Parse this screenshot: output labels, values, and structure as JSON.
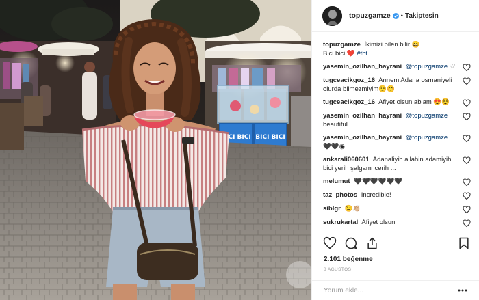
{
  "post": {
    "username": "topuzgamze",
    "verified": true,
    "follow_label": "Takiptesin",
    "caption_text": "İkimizi bilen bilir 😄",
    "caption_line2": "Bici bici",
    "caption_heart": "❤️",
    "caption_tag": "#tbt",
    "likes": "2.101 beğenme",
    "date": "8 AĞUSTOS",
    "comment_placeholder": "Yorum ekle..."
  },
  "photo": {
    "sign_text_1": "BICI BICI",
    "sign_text_2": "BICI BICI"
  },
  "comments": [
    {
      "user": "yasemin_ozilhan_hayrani",
      "mention": "@topuzgamze",
      "text": "♡"
    },
    {
      "user": "tugceacikgoz_16",
      "mention": "",
      "text": "Annem Adana osmaniyeli olurda bilmezmiyim😉😊"
    },
    {
      "user": "tugceacikgoz_16",
      "mention": "",
      "text": "Afiyet olsun ablam 😍😵"
    },
    {
      "user": "yasemin_ozilhan_hayrani",
      "mention": "@topuzgamze",
      "text": "beautiful"
    },
    {
      "user": "yasemin_ozilhan_hayrani",
      "mention": "@topuzgamze",
      "text": "🖤🖤◉"
    },
    {
      "user": "ankarali060601",
      "mention": "",
      "text": "Adanaliyih allahin adamiyih bici yerih şalgam icerih ..."
    },
    {
      "user": "melumut",
      "mention": "",
      "text": "🖤🖤🖤🖤🖤🖤"
    },
    {
      "user": "taz_photos",
      "mention": "",
      "text": "Incredible!"
    },
    {
      "user": "siblgr",
      "mention": "",
      "text": "😉👏🏼"
    },
    {
      "user": "sukrukartal",
      "mention": "",
      "text": "Afiyet olsun"
    }
  ],
  "icons": {
    "like": "heart-outline-icon",
    "comment": "speech-bubble-icon",
    "share": "share-icon",
    "save": "bookmark-icon",
    "more": "more-dots-icon"
  },
  "colors": {
    "link": "#003569",
    "verified": "#3897f0",
    "muted": "#999999",
    "border": "#efefef"
  }
}
